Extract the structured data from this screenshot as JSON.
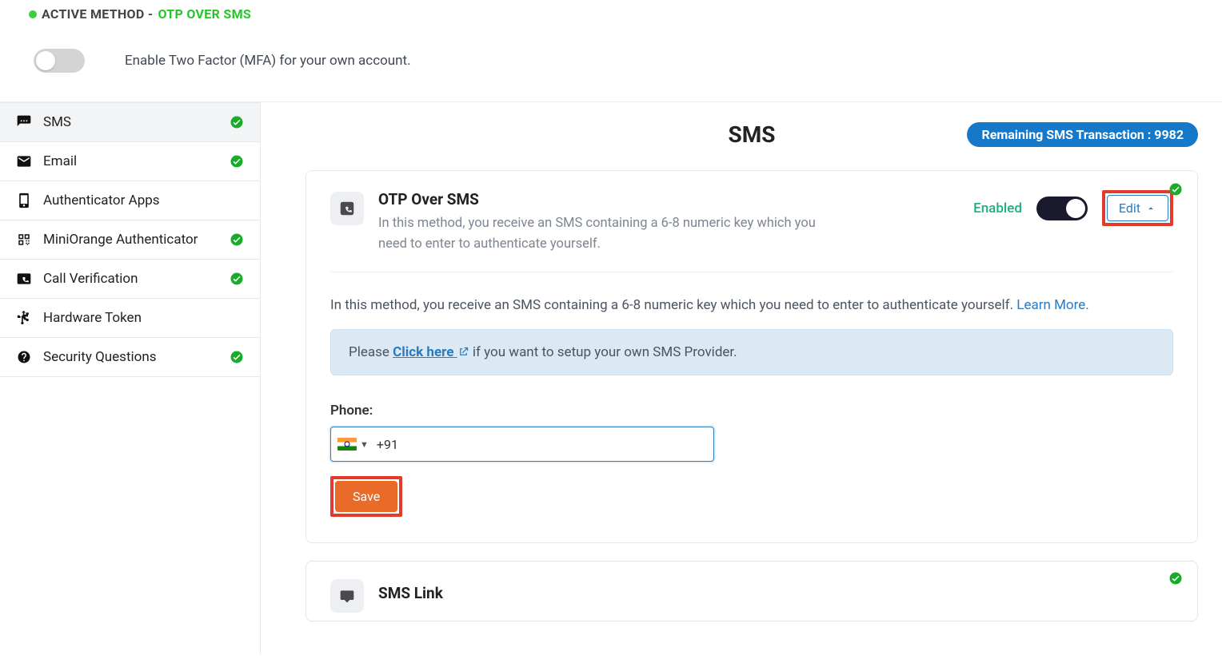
{
  "header": {
    "active_method_label": "ACTIVE METHOD - ",
    "active_method_value": "OTP OVER SMS",
    "enable_desc": "Enable Two Factor (MFA) for your own account."
  },
  "sidebar": {
    "items": [
      {
        "label": "SMS",
        "has_check": true,
        "active": true
      },
      {
        "label": "Email",
        "has_check": true,
        "active": false
      },
      {
        "label": "Authenticator Apps",
        "has_check": false,
        "active": false
      },
      {
        "label": "MiniOrange Authenticator",
        "has_check": true,
        "active": false
      },
      {
        "label": "Call Verification",
        "has_check": true,
        "active": false
      },
      {
        "label": "Hardware Token",
        "has_check": false,
        "active": false
      },
      {
        "label": "Security Questions",
        "has_check": true,
        "active": false
      }
    ]
  },
  "main": {
    "title": "SMS",
    "remaining_label": "Remaining SMS Transaction : 9982",
    "otp_card": {
      "title": "OTP Over SMS",
      "sub": "In this method, you receive an SMS containing a 6-8 numeric key which you need to enter to authenticate yourself.",
      "enabled_text": "Enabled",
      "edit_label": "Edit",
      "body_desc_prefix": "In this method, you receive an SMS containing a 6-8 numeric key which you need to enter to authenticate yourself. ",
      "learn_more": "Learn More.",
      "alert_prefix": "Please ",
      "alert_link": "Click here",
      "alert_suffix": " if you want to setup your own SMS Provider.",
      "phone_label": "Phone:",
      "phone_value": "+91",
      "save_label": "Save"
    },
    "sms_link_card": {
      "title": "SMS Link"
    }
  }
}
